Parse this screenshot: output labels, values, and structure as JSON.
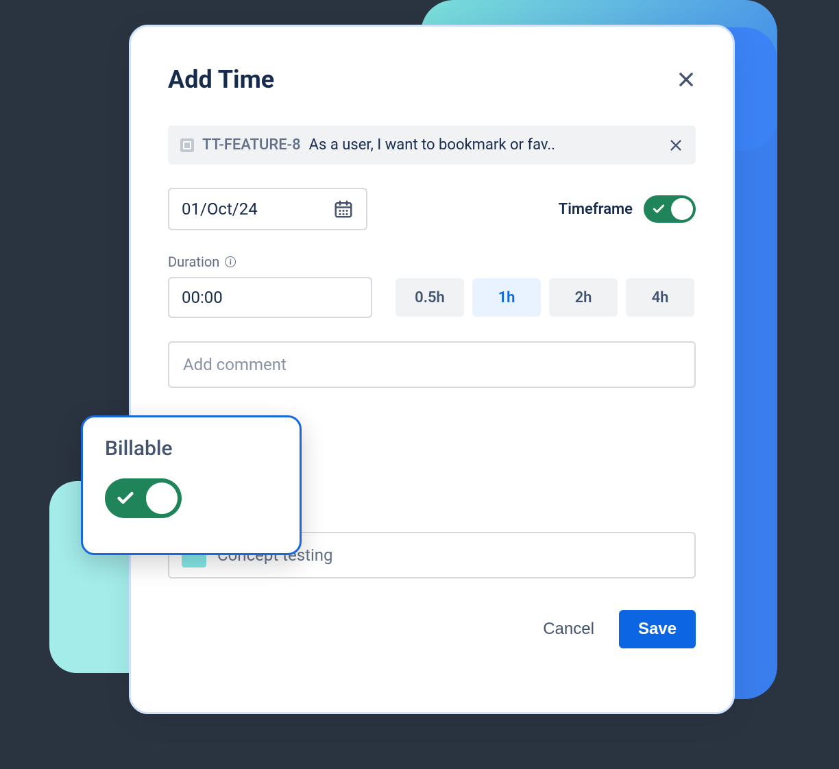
{
  "modal": {
    "title": "Add Time",
    "task": {
      "key": "TT-FEATURE-8",
      "summary": "As a user, I want to bookmark or fav.."
    },
    "date": "01/Oct/24",
    "timeframe": {
      "label": "Timeframe",
      "on": true
    },
    "duration": {
      "label": "Duration",
      "value": "00:00",
      "presets": [
        "0.5h",
        "1h",
        "2h",
        "4h"
      ],
      "active_preset_index": 1
    },
    "comment_placeholder": "Add comment",
    "worktype": {
      "label": "Concept testing",
      "color": "#85e7e7"
    },
    "buttons": {
      "cancel": "Cancel",
      "save": "Save"
    }
  },
  "billable_card": {
    "title": "Billable",
    "on": true
  }
}
